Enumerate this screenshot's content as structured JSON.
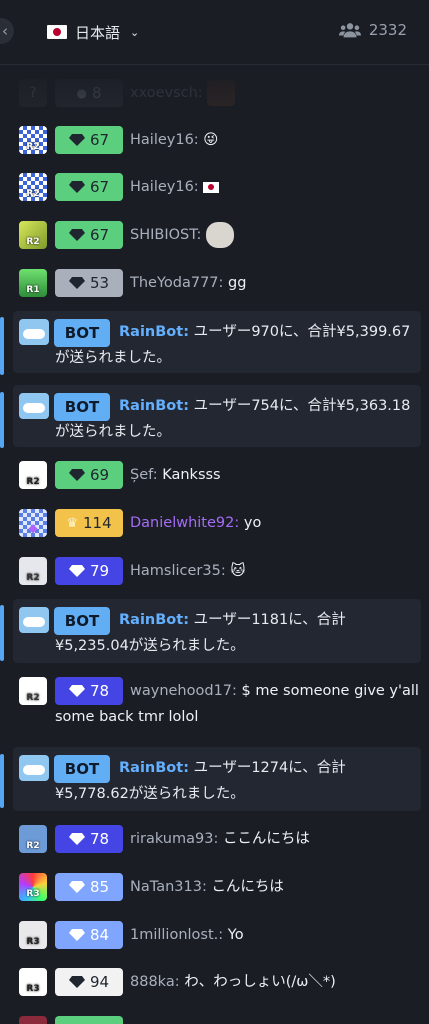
{
  "header": {
    "language_label": "日本語",
    "online_count": "2332"
  },
  "rows": [
    {
      "badge": "8",
      "user": "xxoevsch:",
      "text": ""
    },
    {
      "badge": "67",
      "user": "Hailey16:",
      "text": "😜"
    },
    {
      "badge": "67",
      "user": "Hailey16:",
      "text": ""
    },
    {
      "badge": "67",
      "user": "SHIBIOST:",
      "text": ""
    },
    {
      "badge": "53",
      "user": "TheYoda777:",
      "text": "gg"
    },
    {
      "badge": "69",
      "user": "Șef:",
      "text": "Kanksss"
    },
    {
      "badge": "114",
      "user": "Danielwhite92:",
      "text": "yo"
    },
    {
      "badge": "79",
      "user": "Hamslicer35:",
      "text": "🐱"
    },
    {
      "badge": "78",
      "user": "waynehood17:",
      "text": "$ me someone give y'all",
      "text2": "some back tmr lolol"
    },
    {
      "badge": "78",
      "user": "rirakuma93:",
      "text": "ここんにちは"
    },
    {
      "badge": "85",
      "user": "NaTan313:",
      "text": "こんにちは"
    },
    {
      "badge": "84",
      "user": "1millionlost.:",
      "text": "Yo"
    },
    {
      "badge": "94",
      "user": "888ka:",
      "text": "わ、わっしょい(/ω＼*)"
    }
  ],
  "bot_messages": [
    {
      "tag": "BOT",
      "name": "RainBot:",
      "text": "ユーザー970に、合計¥5,399.67が送られました。"
    },
    {
      "tag": "BOT",
      "name": "RainBot:",
      "text": "ユーザー754に、合計¥5,363.18が送られました。"
    },
    {
      "tag": "BOT",
      "name": "RainBot:",
      "text": "ユーザー1181に、合計¥5,235.04が送られました。"
    },
    {
      "tag": "BOT",
      "name": "RainBot:",
      "text": "ユーザー1274に、合計¥5,778.62が送られました。"
    }
  ],
  "avatar_ranks": [
    "R2",
    "R2",
    "R2",
    "R2",
    "R1",
    "R2",
    "R2",
    "R2",
    "R2",
    "R2",
    "R3",
    "R3",
    "R3"
  ],
  "colors": {
    "badge_green": "#5ccf7f",
    "badge_gray": "#a9b0bb",
    "badge_blue": "#4545e6",
    "badge_lightblue": "#7fa5ff",
    "badge_gold": "#f3c24a",
    "badge_white": "#f2f2f2",
    "bot_accent": "#62aef5",
    "purple_name": "#a56cf5"
  }
}
